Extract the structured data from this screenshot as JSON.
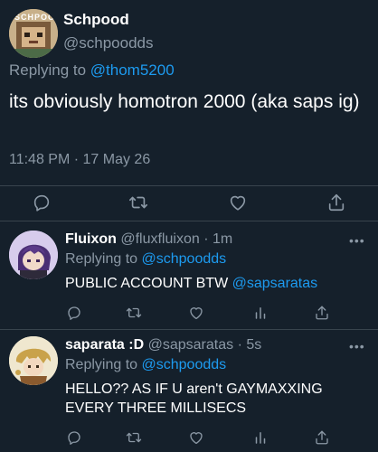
{
  "main_tweet": {
    "display_name": "Schpood",
    "handle": "@schpoodds",
    "replying_prefix": "Replying to",
    "replying_to": "@thom5200",
    "text": "its obviously homotron 2000 (aka saps ig)",
    "timestamp": "11:48 PM · 17 May 26",
    "avatar_text": "SCHPOO"
  },
  "replies": [
    {
      "display_name": "Fluixon",
      "handle": "@fluxfluixon",
      "time": "· 1m",
      "replying_prefix": "Replying to",
      "replying_to": "@schpoodds",
      "text": "PUBLIC ACCOUNT BTW ",
      "mention": "@sapsaratas"
    },
    {
      "display_name": "saparata :D",
      "handle": "@sapsaratas",
      "time": "· 5s",
      "replying_prefix": "Replying to",
      "replying_to": "@schpoodds",
      "text": "HELLO?? AS IF U aren't GAYMAXXING EVERY THREE MILLISECS"
    }
  ],
  "more_label": "•••",
  "icons": [
    "reply-icon",
    "retweet-icon",
    "like-icon",
    "share-icon",
    "analytics-icon",
    "more-icon"
  ],
  "colors": {
    "background": "#15202b",
    "accent": "#1d9bf0",
    "muted": "#8b98a5",
    "divider": "#38444d"
  }
}
